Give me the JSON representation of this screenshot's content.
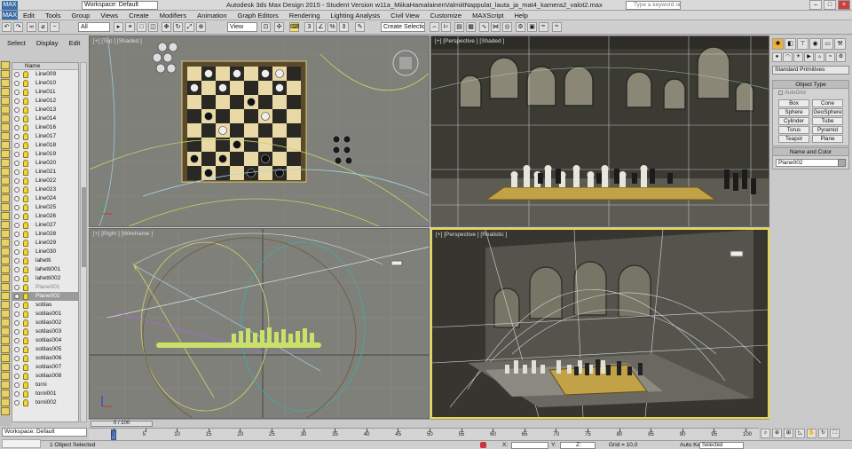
{
  "titlebar": {
    "workspace": "Workspace: Default",
    "title": "Autodesk 3ds Max Design 2015  -  Student Version     w11a_MiikaHamalainenValmiitNappulat_lauta_ja_mat4_kamera2_valot2.max",
    "search_placeholder": "Type a keyword or phrase",
    "logo": "MAX"
  },
  "menubar": [
    "Edit",
    "Tools",
    "Group",
    "Views",
    "Create",
    "Modifiers",
    "Animation",
    "Graph Editors",
    "Rendering",
    "Lighting Analysis",
    "Civil View",
    "Customize",
    "MAXScript",
    "Help"
  ],
  "toolbar": {
    "selection_filter": "All",
    "reference_coord": "View",
    "named_selection": "Create Selection Se"
  },
  "explorer": {
    "tabs": [
      "Select",
      "Display",
      "Edit"
    ],
    "column_header": "Name",
    "rows": [
      {
        "name": "Line009",
        "state": "normal"
      },
      {
        "name": "Line010",
        "state": "normal"
      },
      {
        "name": "Line011",
        "state": "normal"
      },
      {
        "name": "Line012",
        "state": "normal"
      },
      {
        "name": "Line013",
        "state": "normal"
      },
      {
        "name": "Line014",
        "state": "normal"
      },
      {
        "name": "Line016",
        "state": "normal"
      },
      {
        "name": "Line017",
        "state": "normal"
      },
      {
        "name": "Line018",
        "state": "normal"
      },
      {
        "name": "Line019",
        "state": "normal"
      },
      {
        "name": "Line020",
        "state": "normal"
      },
      {
        "name": "Line021",
        "state": "normal"
      },
      {
        "name": "Line022",
        "state": "normal"
      },
      {
        "name": "Line023",
        "state": "normal"
      },
      {
        "name": "Line024",
        "state": "normal"
      },
      {
        "name": "Line025",
        "state": "normal"
      },
      {
        "name": "Line026",
        "state": "normal"
      },
      {
        "name": "Line027",
        "state": "normal"
      },
      {
        "name": "Line028",
        "state": "normal"
      },
      {
        "name": "Line029",
        "state": "normal"
      },
      {
        "name": "Line030",
        "state": "normal"
      },
      {
        "name": "lahetti",
        "state": "normal"
      },
      {
        "name": "lahetti001",
        "state": "normal"
      },
      {
        "name": "lahetti002",
        "state": "normal"
      },
      {
        "name": "Plane001",
        "state": "dim"
      },
      {
        "name": "Plane002",
        "state": "selected"
      },
      {
        "name": "sotilas",
        "state": "normal"
      },
      {
        "name": "sotilas001",
        "state": "normal"
      },
      {
        "name": "sotilas002",
        "state": "normal"
      },
      {
        "name": "sotilas003",
        "state": "normal"
      },
      {
        "name": "sotilas004",
        "state": "normal"
      },
      {
        "name": "sotilas005",
        "state": "normal"
      },
      {
        "name": "sotilas006",
        "state": "normal"
      },
      {
        "name": "sotilas007",
        "state": "normal"
      },
      {
        "name": "sotilas008",
        "state": "normal"
      },
      {
        "name": "torni",
        "state": "normal"
      },
      {
        "name": "torni001",
        "state": "normal"
      },
      {
        "name": "torni002",
        "state": "normal"
      }
    ]
  },
  "viewports": {
    "top": "[+] [Top ] [Shaded ]",
    "persp1": "[+] [Perspective ] [Shaded ]",
    "right": "[+] [Right ] [Wireframe ]",
    "persp2": "[+] [Perspective ] [Realistic ]"
  },
  "cmdpanel": {
    "category": "Standard Primitives",
    "object_type_title": "Object Type",
    "autogrid": "AutoGrid",
    "buttons": [
      "Box",
      "Cone",
      "Sphere",
      "GeoSphere",
      "Cylinder",
      "Tube",
      "Torus",
      "Pyramid",
      "Teapot",
      "Plane"
    ],
    "name_color_title": "Name and Color",
    "object_name": "Plane002"
  },
  "bottom": {
    "workspace": "Workspace: Default",
    "maxscript": "",
    "frame_range": "0 / 100",
    "ruler_ticks": [
      "0",
      "5",
      "10",
      "15",
      "20",
      "25",
      "30",
      "35",
      "40",
      "45",
      "50",
      "55",
      "60",
      "65",
      "70",
      "75",
      "80",
      "85",
      "90",
      "95",
      "100"
    ],
    "status": "1 Object Selected",
    "x_label": "X:",
    "y_label": "Y:",
    "z_label": "Z:",
    "grid": "Grid = 10,0",
    "autokey": "Auto Key",
    "selected_option": "Selected"
  },
  "colors": {
    "accent_yellow": "#e9d54a",
    "selection_gray": "#9a9a9a"
  }
}
